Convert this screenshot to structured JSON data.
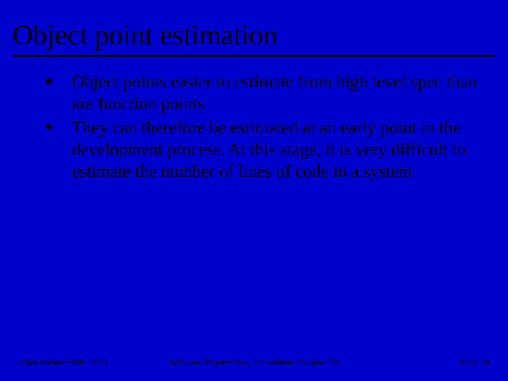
{
  "title": "Object point estimation",
  "bullets": [
    "Object points easier to estimate from high level spec than are function points",
    "They can therefore be estimated at an early point in the development process. At this stage, it is very difficult to estimate the number of lines of code in a system"
  ],
  "footer": {
    "left": "©Ian Sommerville 2000",
    "center": "Software Engineering, 6th edition. Chapter 23",
    "right": "Slide 18"
  }
}
